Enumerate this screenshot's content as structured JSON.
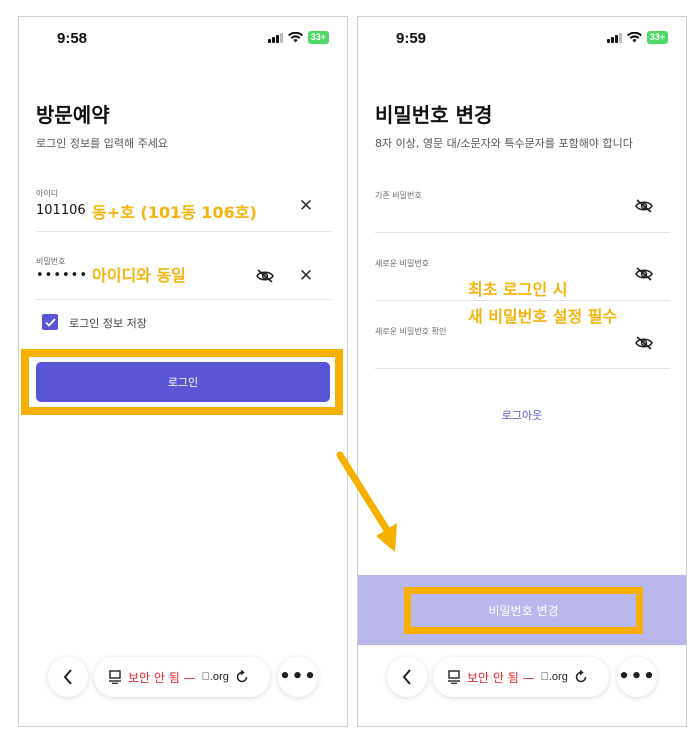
{
  "left_screen": {
    "status_time": "9:58",
    "battery": "33+",
    "title": "방문예약",
    "subtitle": "로그인 정보를 입력해 주세요",
    "id_field": {
      "label": "아이디",
      "value": "101106",
      "annotation": "동+호 (101동 106호)"
    },
    "password_field": {
      "label": "비밀번호",
      "value": "••••••",
      "annotation": "아이디와 동일"
    },
    "remember_label": "로그인 정보 저장",
    "login_button": "로그인"
  },
  "right_screen": {
    "status_time": "9:59",
    "battery": "33+",
    "title": "비밀번호 변경",
    "subtitle": "8자 이상, 영문 대/소문자와 특수문자를 포함해야 합니다",
    "fields": [
      {
        "label": "기존 비밀번호"
      },
      {
        "label": "새로운 비밀번호"
      },
      {
        "label": "새로운 비밀번호 확인"
      }
    ],
    "annotation_line1": "최초 로그인 시",
    "annotation_line2": "새 비밀번호 설정 필수",
    "logout_link": "로그아웃",
    "change_button": "비밀번호 변경"
  },
  "browser": {
    "security_text": "보안 안 됨 —",
    "domain": "\u0000.org"
  },
  "colors": {
    "accent": "#5a55d4",
    "highlight": "#f6b100",
    "annotation": "#f5b30e",
    "unsafe": "#e0242e"
  },
  "icons": [
    "signal-icon",
    "wifi-icon",
    "clear-icon",
    "eye-off-icon",
    "checkmark-icon",
    "back-icon",
    "reader-icon",
    "reload-icon",
    "more-icon",
    "arrow-annotation"
  ]
}
